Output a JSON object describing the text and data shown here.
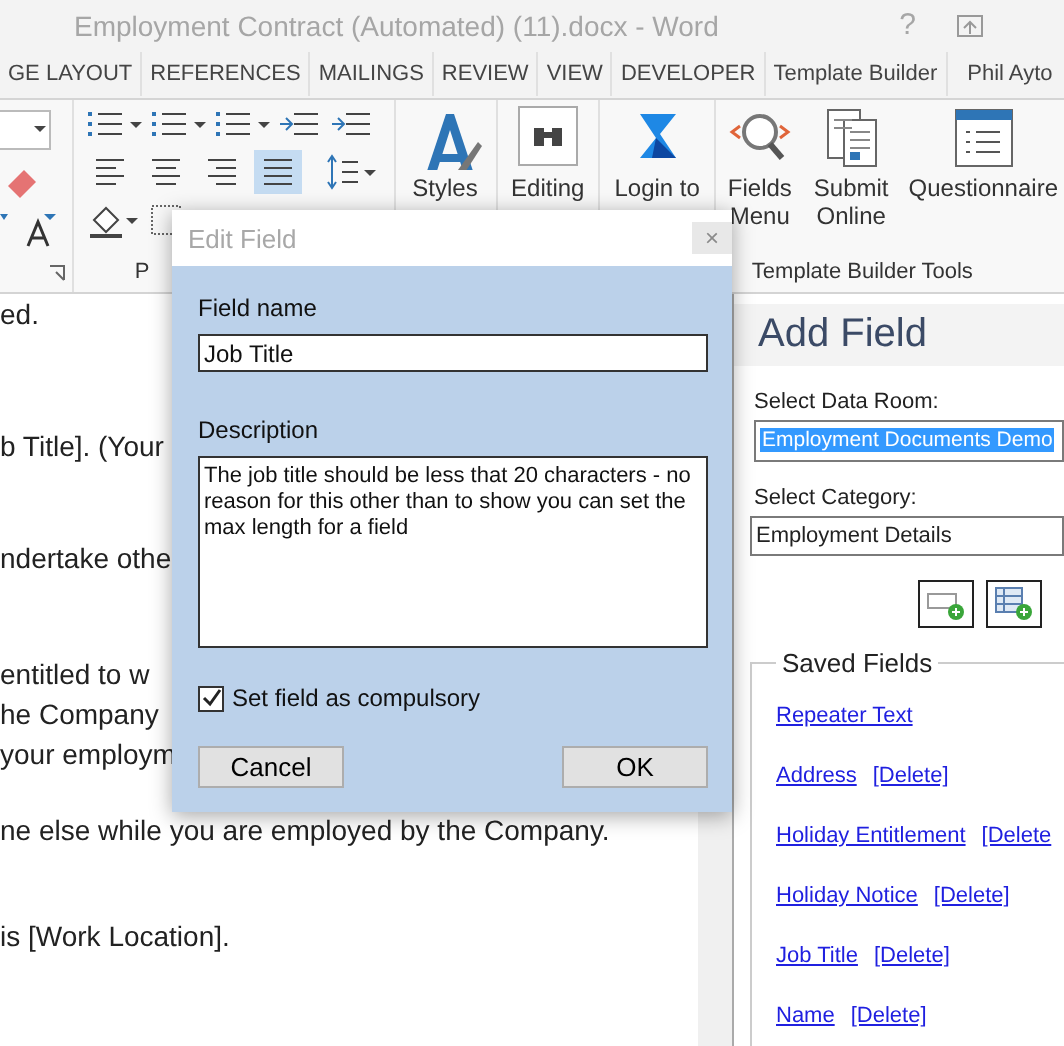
{
  "window": {
    "title": "Employment Contract (Automated) (11).docx - Word",
    "help": "?"
  },
  "tabs": [
    "GE LAYOUT",
    "REFERENCES",
    "MAILINGS",
    "REVIEW",
    "VIEW",
    "DEVELOPER",
    "Template Builder",
    "Phil Ayto"
  ],
  "ribbon": {
    "alignment": [
      {
        "selected": false
      },
      {
        "selected": false
      },
      {
        "selected": false
      },
      {
        "selected": true
      }
    ],
    "paragraph_group": "P",
    "buttons": [
      {
        "kind": "styles",
        "label": "Styles"
      },
      {
        "kind": "editing",
        "label": "Editing"
      },
      {
        "kind": "login",
        "label": "Login to"
      }
    ],
    "tools": [
      {
        "kind": "fields",
        "label": "Fields Menu"
      },
      {
        "kind": "submit",
        "label": "Submit Online"
      },
      {
        "kind": "questionnaire",
        "label": "Questionnaire"
      }
    ],
    "tools_group": "Template Builder Tools"
  },
  "document": {
    "lines": [
      "ed.",
      "b Title]. (Your",
      "ndertake othe",
      "entitled to w",
      "he Company",
      "your employm",
      "ne else while you are employed by the Company.",
      "is [Work Location]."
    ]
  },
  "pane": {
    "title": "Add Field",
    "data_room_label": "Select Data Room:",
    "data_room": "Employment Documents Demo",
    "category_label": "Select Category:",
    "category": "Employment Details",
    "saved_fields": "Saved Fields",
    "fields": [
      {
        "name": "Repeater Text"
      },
      {
        "name": "Address",
        "action": "[Delete]"
      },
      {
        "name": "Holiday Entitlement",
        "action": "[Delete"
      },
      {
        "name": "Holiday Notice",
        "action": "[Delete]"
      },
      {
        "name": "Job Title",
        "action": "[Delete]"
      },
      {
        "name": "Name",
        "action": "[Delete]"
      }
    ]
  },
  "dialog": {
    "title": "Edit Field",
    "close": "×",
    "name_label": "Field name",
    "name_value": "Job Title",
    "description_label": "Description",
    "description_value": "The job title should be less that 20 characters - no reason for this other than to show you can set the max length for a field",
    "compulsory": {
      "label": "Set field as compulsory",
      "checked": true
    },
    "buttons": [
      "Cancel",
      "OK"
    ]
  }
}
